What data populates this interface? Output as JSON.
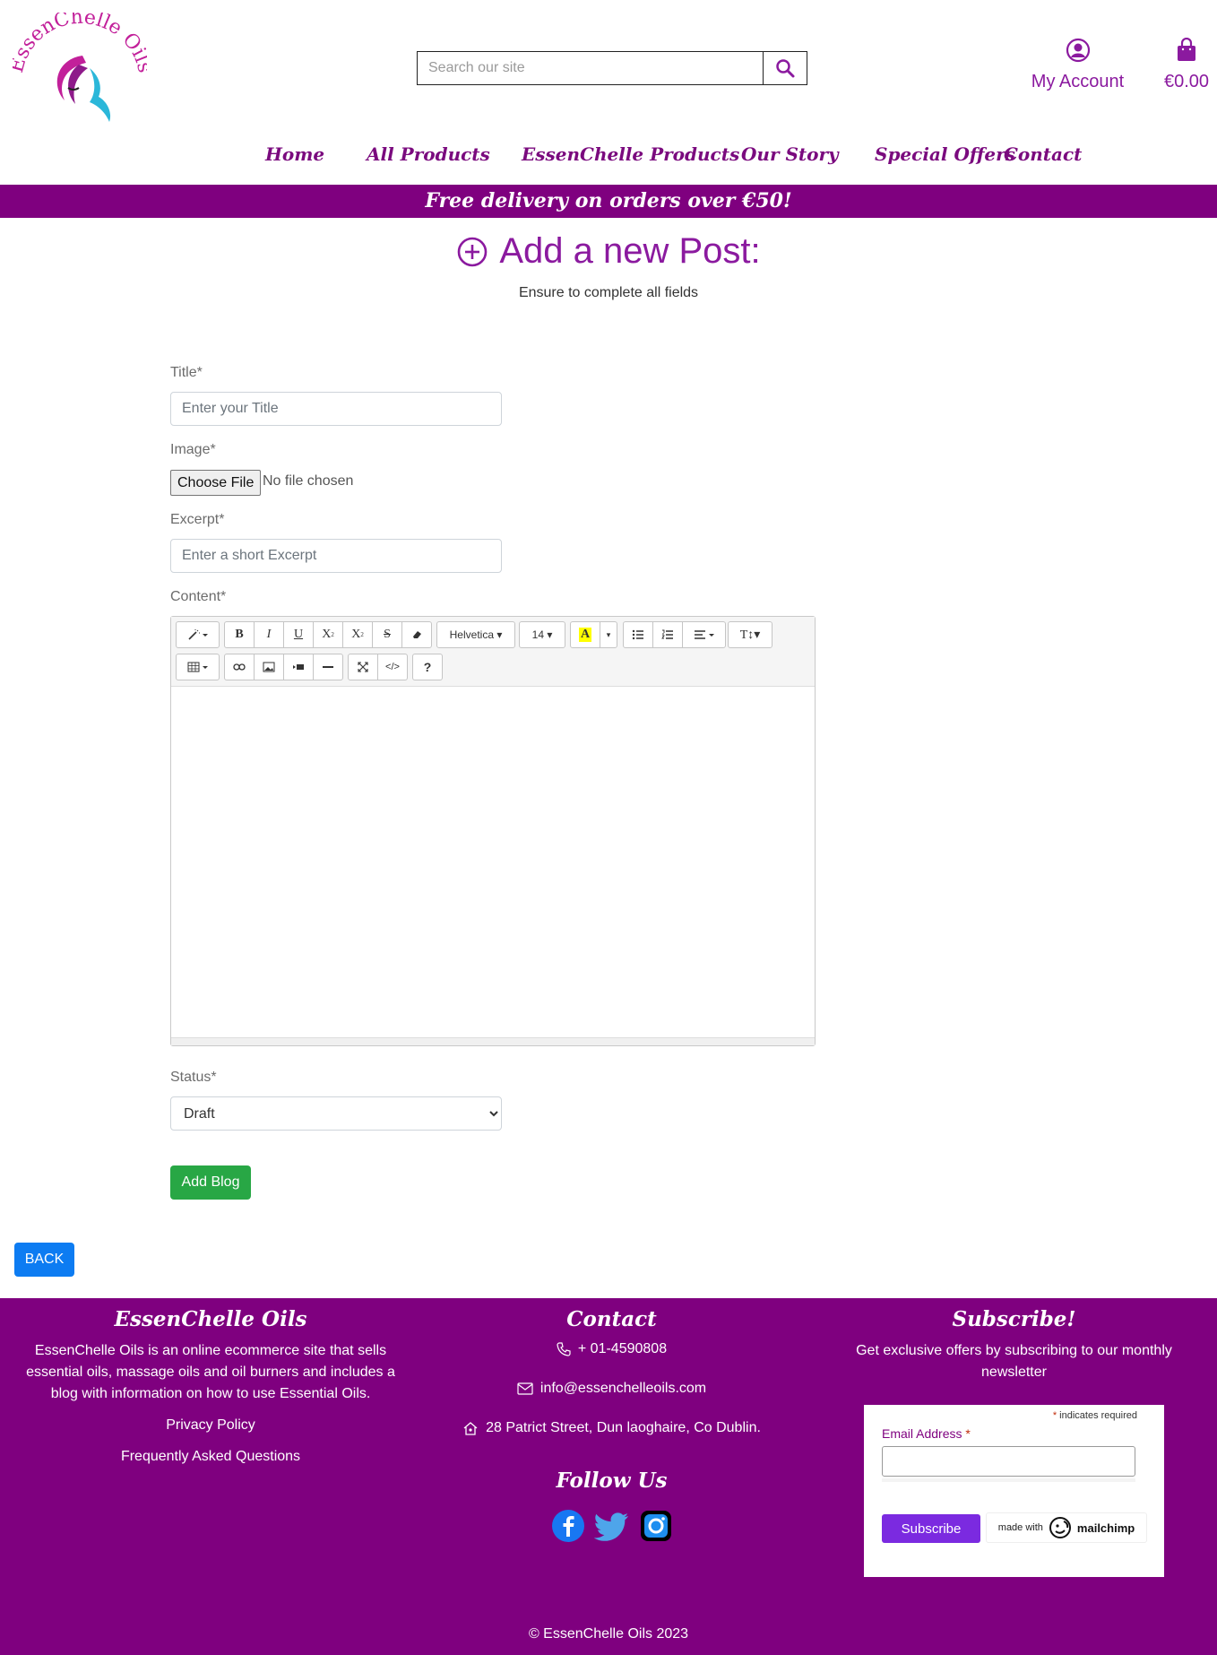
{
  "header": {
    "logo_text": "EssenChelle Oils",
    "search_placeholder": "Search our site",
    "account_label": "My Account",
    "cart_total": "€0.00"
  },
  "nav": {
    "items": [
      "Home",
      "All Products",
      "EssenChelle Products",
      "Our Story",
      "Special Offers",
      "Contact"
    ]
  },
  "banner": {
    "text": "Free delivery on orders over €50!"
  },
  "page": {
    "title": "Add a new Post:",
    "subtitle": "Ensure to complete all fields"
  },
  "form": {
    "title_label": "Title*",
    "title_placeholder": "Enter your Title",
    "image_label": "Image*",
    "file_button": "Choose File",
    "file_status": "No file chosen",
    "excerpt_label": "Excerpt*",
    "excerpt_placeholder": "Enter a short Excerpt",
    "content_label": "Content*",
    "toolbar": {
      "font_name": "Helvetica",
      "font_size": "14"
    },
    "status_label": "Status*",
    "status_value": "Draft",
    "submit_label": "Add Blog"
  },
  "back_label": "BACK",
  "colors": {
    "brand_purple": "#7f007f",
    "accent_purple": "#8b1a9f",
    "success_green": "#28a745",
    "primary_blue": "#0d7cf2",
    "mailchimp_purple": "#7b2ae0"
  },
  "footer": {
    "about": {
      "title": "EssenChelle Oils",
      "text": "EssenChelle Oils is an online ecommerce site that sells essential oils, massage oils and oil burners and includes a blog with information on how to use Essential Oils.",
      "links": [
        "Privacy Policy",
        "Frequently Asked Questions"
      ]
    },
    "contact": {
      "title": "Contact",
      "phone": "+ 01-4590808",
      "email": "info@essenchelleoils.com",
      "address": "28 Patrict Street, Dun laoghaire, Co Dublin.",
      "follow_title": "Follow Us"
    },
    "subscribe": {
      "title": "Subscribe!",
      "text": "Get exclusive offers by subscribing to our monthly newsletter",
      "required_note": "indicates required",
      "email_label": "Email Address",
      "button": "Subscribe",
      "made_with": "made with",
      "brand": "mailchimp"
    },
    "copyright": "© EssenChelle Oils 2023"
  }
}
